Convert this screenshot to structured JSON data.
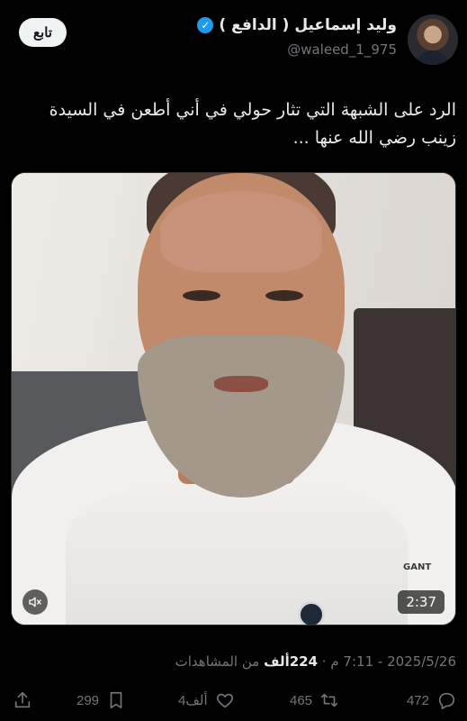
{
  "author": {
    "name": "وليد إسماعيل ( الدافع )",
    "handle": "@waleed_1_975",
    "verified": true,
    "follow_label": "تابع"
  },
  "tweet": {
    "text": "الرد على الشبهة التي تثار حولي في أني أطعن في السيدة زينب رضي الله عنها ..."
  },
  "video": {
    "duration": "2:37",
    "mute_icon": "muted-speaker-icon",
    "shirt_brand": "GANT"
  },
  "meta": {
    "date": "2025/5/26",
    "time": "7:11 م",
    "views_count": "224ألف",
    "views_label": "من المشاهدات"
  },
  "actions": {
    "replies": "472",
    "retweets": "465",
    "likes": "4ألف",
    "bookmarks": "299"
  },
  "colors": {
    "background": "#000000",
    "text": "#e7e9ea",
    "secondary": "#71767b",
    "verified": "#1d9bf0"
  }
}
